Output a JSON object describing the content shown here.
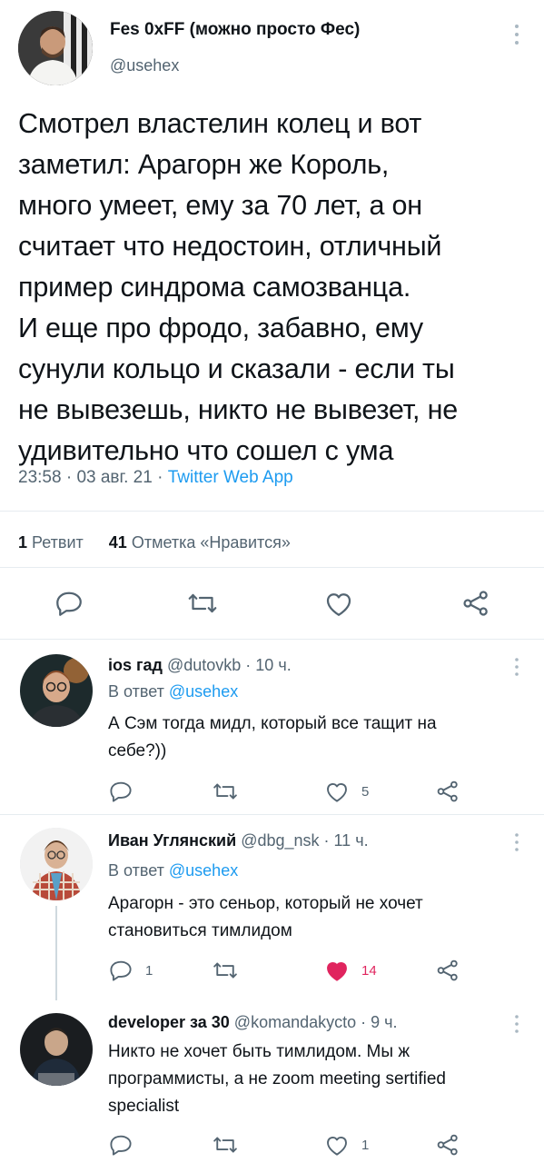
{
  "main_tweet": {
    "author_name": "Fes 0xFF (можно просто Фес)",
    "author_handle": "@usehex",
    "text": "Смотрел властелин колец и вот\nзаметил: Арагорн же Король,\nмного умеет, ему за 70 лет, а он\nсчитает что недостоин, отличный\nпример синдрома самозванца.\nИ еще про фродо, забавно, ему\nсунули кольцо и сказали - если ты\nне вывезешь, никто не вывезет, не\nудивительно что сошел с ума",
    "time": "23:58",
    "sep1": " · ",
    "date": "03 авг. 21",
    "sep2": " · ",
    "client": "Twitter Web App",
    "retweet_count": "1",
    "retweet_label": "Ретвит",
    "like_count": "41",
    "like_label": "Отметка «Нравится»",
    "actions": [
      "reply-icon",
      "retweet-icon",
      "like-icon",
      "share-icon"
    ]
  },
  "replies": [
    {
      "name": "ios гад",
      "handle": "@dutovkb",
      "time": " · 10 ч.",
      "reply_prefix": "В ответ ",
      "reply_to": "@usehex",
      "text": "А Сэм тогда мидл, который все тащит на\nсебе?))",
      "reply_count": "",
      "like_count": "5",
      "liked": false
    },
    {
      "name": "Иван Углянский",
      "handle": "@dbg_nsk",
      "time": " · 11 ч.",
      "reply_prefix": "В ответ ",
      "reply_to": "@usehex",
      "text": "Арагорн - это сеньор, который не хочет\nстановиться тимлидом",
      "reply_count": "1",
      "like_count": "14",
      "liked": true
    },
    {
      "name": "developer за 30",
      "handle": "@komandakycto",
      "time": " · 9 ч.",
      "text": "Никто не хочет быть тимлидом. Мы ж\nпрограммисты, а не zoom meeting sertified\nspecialist",
      "reply_count": "",
      "like_count": "1",
      "liked": false
    }
  ],
  "colors": {
    "text": "#0f1419",
    "secondary": "#536471",
    "link": "#1d9bf0",
    "like_active": "#e0245e",
    "divider": "#e6ecf0"
  }
}
